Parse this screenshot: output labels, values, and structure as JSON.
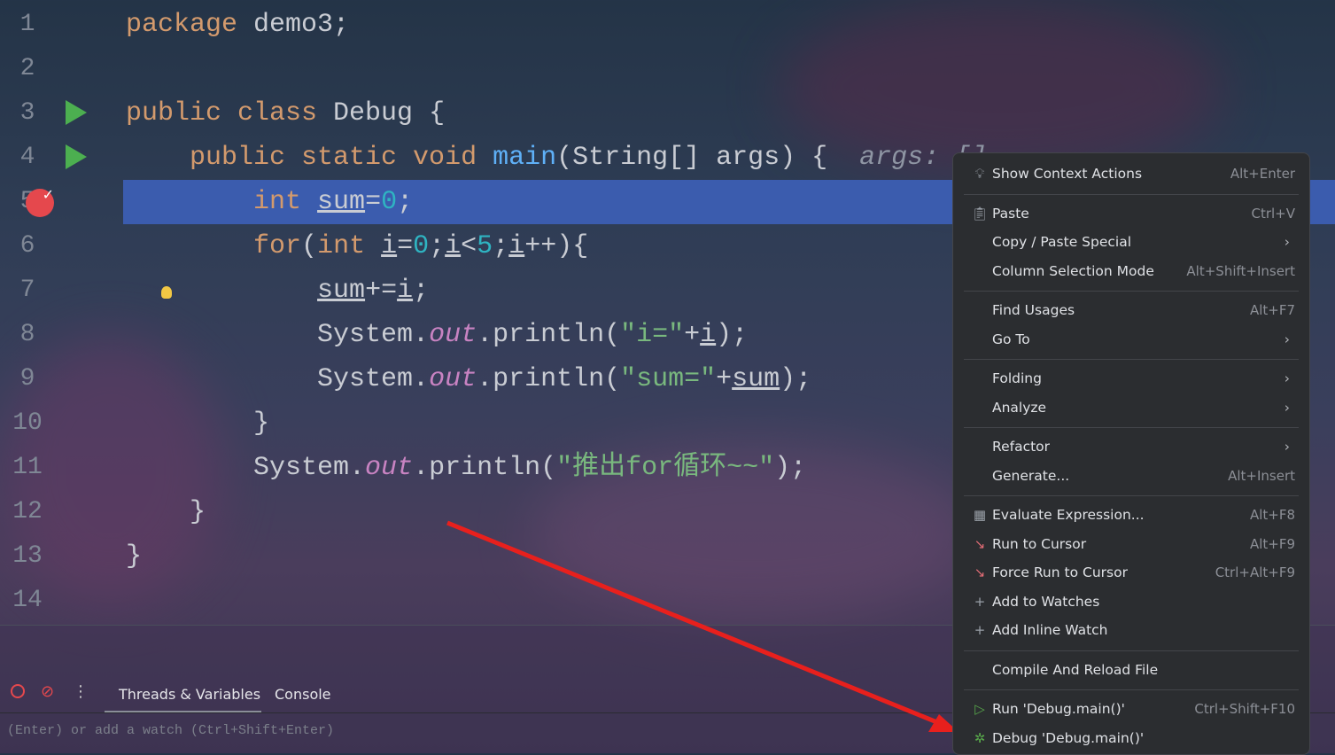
{
  "editor": {
    "lines": [
      {
        "n": "1",
        "tokens": [
          [
            "kw",
            "package "
          ],
          [
            "",
            "demo3;"
          ]
        ]
      },
      {
        "n": "2",
        "tokens": []
      },
      {
        "n": "3",
        "run": true,
        "tokens": [
          [
            "kw",
            "public class "
          ],
          [
            "",
            "Debug {"
          ]
        ]
      },
      {
        "n": "4",
        "run": true,
        "tokens": [
          [
            "",
            "    "
          ],
          [
            "kw",
            "public static void "
          ],
          [
            "fn",
            "main"
          ],
          [
            "",
            "(String[] args) {  "
          ],
          [
            "hint",
            "args: []"
          ]
        ]
      },
      {
        "n": "5",
        "breakpoint": true,
        "highlight": true,
        "tokens": [
          [
            "",
            "        "
          ],
          [
            "kw",
            "int "
          ],
          [
            "u",
            "sum"
          ],
          [
            "",
            "="
          ],
          [
            "num",
            "0"
          ],
          [
            "",
            ";"
          ]
        ]
      },
      {
        "n": "6",
        "tokens": [
          [
            "",
            "        "
          ],
          [
            "kw",
            "for"
          ],
          [
            "",
            "("
          ],
          [
            "kw",
            "int "
          ],
          [
            "u",
            "i"
          ],
          [
            "",
            "="
          ],
          [
            "num",
            "0"
          ],
          [
            "",
            ";"
          ],
          [
            "u",
            "i"
          ],
          [
            "",
            "<"
          ],
          [
            "num",
            "5"
          ],
          [
            "",
            ";"
          ],
          [
            "u",
            "i"
          ],
          [
            "",
            "++){"
          ]
        ]
      },
      {
        "n": "7",
        "bulb": true,
        "tokens": [
          [
            "",
            "            "
          ],
          [
            "u",
            "sum"
          ],
          [
            "",
            "+="
          ],
          [
            "u",
            "i"
          ],
          [
            "",
            ";"
          ]
        ]
      },
      {
        "n": "8",
        "tokens": [
          [
            "",
            "            System."
          ],
          [
            "fld",
            "out"
          ],
          [
            "",
            ".println("
          ],
          [
            "str",
            "\"i=\""
          ],
          [
            "",
            "+"
          ],
          [
            "u",
            "i"
          ],
          [
            "",
            ");"
          ]
        ]
      },
      {
        "n": "9",
        "tokens": [
          [
            "",
            "            System."
          ],
          [
            "fld",
            "out"
          ],
          [
            "",
            ".println("
          ],
          [
            "str",
            "\"sum=\""
          ],
          [
            "",
            "+"
          ],
          [
            "u",
            "sum"
          ],
          [
            "",
            ");"
          ]
        ]
      },
      {
        "n": "10",
        "tokens": [
          [
            "",
            "        }"
          ]
        ]
      },
      {
        "n": "11",
        "tokens": [
          [
            "",
            "        System."
          ],
          [
            "fld",
            "out"
          ],
          [
            "",
            ".println("
          ],
          [
            "str",
            "\"推出for循环~~\""
          ],
          [
            "",
            ");"
          ]
        ]
      },
      {
        "n": "12",
        "tokens": [
          [
            "",
            "    }"
          ]
        ]
      },
      {
        "n": "13",
        "tokens": [
          [
            "",
            "}"
          ]
        ]
      },
      {
        "n": "14",
        "tokens": []
      }
    ]
  },
  "debug_panel": {
    "tabs": [
      "Threads & Variables",
      "Console"
    ],
    "watch_placeholder": "(Enter) or add a watch (Ctrl+Shift+Enter)"
  },
  "context_menu": [
    {
      "label": "Show Context Actions",
      "shortcut": "Alt+Enter",
      "icon": "lightbulb-icon",
      "glyph": "💡︎"
    },
    {
      "sep": true
    },
    {
      "label": "Paste",
      "shortcut": "Ctrl+V",
      "icon": "clipboard-icon",
      "glyph": "📋︎"
    },
    {
      "label": "Copy / Paste Special",
      "submenu": true
    },
    {
      "label": "Column Selection Mode",
      "shortcut": "Alt+Shift+Insert"
    },
    {
      "sep": true
    },
    {
      "label": "Find Usages",
      "shortcut": "Alt+F7"
    },
    {
      "label": "Go To",
      "submenu": true
    },
    {
      "sep": true
    },
    {
      "label": "Folding",
      "submenu": true
    },
    {
      "label": "Analyze",
      "submenu": true
    },
    {
      "sep": true
    },
    {
      "label": "Refactor",
      "submenu": true
    },
    {
      "label": "Generate...",
      "shortcut": "Alt+Insert"
    },
    {
      "sep": true
    },
    {
      "label": "Evaluate Expression...",
      "shortcut": "Alt+F8",
      "icon": "calculator-icon",
      "glyph": "▦"
    },
    {
      "label": "Run to Cursor",
      "shortcut": "Alt+F9",
      "icon": "run-to-cursor-icon",
      "glyph": "↘"
    },
    {
      "label": "Force Run to Cursor",
      "shortcut": "Ctrl+Alt+F9",
      "icon": "force-run-to-cursor-icon",
      "glyph": "↘"
    },
    {
      "label": "Add to Watches",
      "icon": "add-watch-icon",
      "glyph": "+"
    },
    {
      "label": "Add Inline Watch",
      "icon": "add-inline-watch-icon",
      "glyph": "+"
    },
    {
      "sep": true
    },
    {
      "label": "Compile And Reload File"
    },
    {
      "sep": true
    },
    {
      "label": "Run 'Debug.main()'",
      "shortcut": "Ctrl+Shift+F10",
      "icon": "run-icon",
      "glyph": "▷"
    },
    {
      "label": "Debug 'Debug.main()'",
      "icon": "debug-bug-icon",
      "glyph": "✲"
    }
  ],
  "colors": {
    "highlight": "#3b5cae",
    "breakpoint": "#e5484d",
    "run": "#4caf50",
    "annotation_arrow": "#e8201d"
  }
}
